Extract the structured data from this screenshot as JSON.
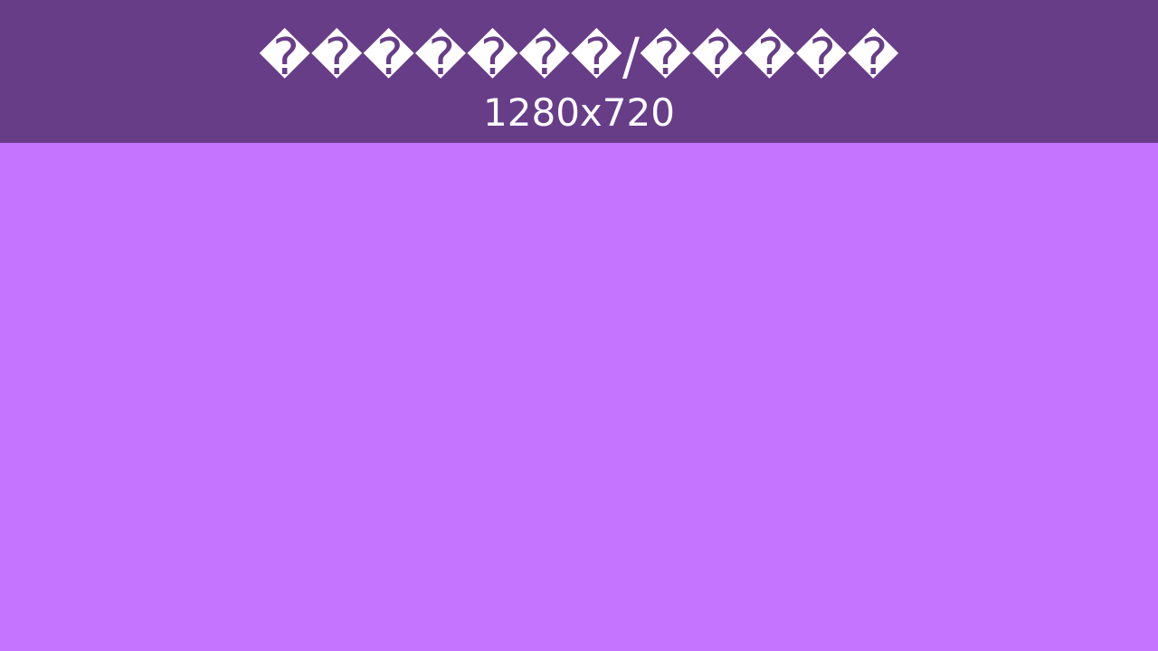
{
  "header": {
    "title": "�������/�����",
    "subtitle": "1280x720"
  },
  "colors": {
    "header_background": "#673d88",
    "content_background": "#c474ff",
    "text": "#ffffff"
  }
}
